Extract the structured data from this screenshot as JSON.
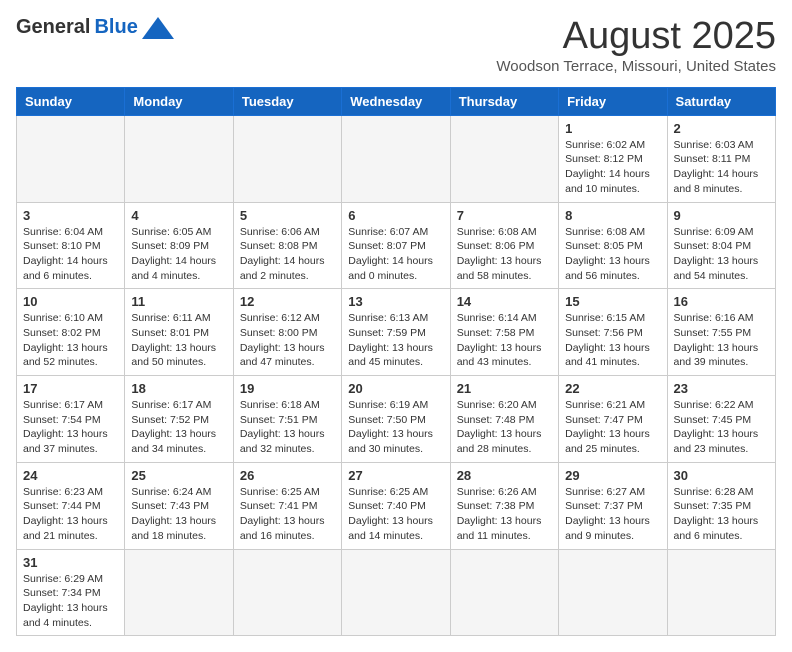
{
  "header": {
    "logo_general": "General",
    "logo_blue": "Blue",
    "month_title": "August 2025",
    "location": "Woodson Terrace, Missouri, United States"
  },
  "weekdays": [
    "Sunday",
    "Monday",
    "Tuesday",
    "Wednesday",
    "Thursday",
    "Friday",
    "Saturday"
  ],
  "weeks": [
    [
      {
        "day": "",
        "info": ""
      },
      {
        "day": "",
        "info": ""
      },
      {
        "day": "",
        "info": ""
      },
      {
        "day": "",
        "info": ""
      },
      {
        "day": "",
        "info": ""
      },
      {
        "day": "1",
        "info": "Sunrise: 6:02 AM\nSunset: 8:12 PM\nDaylight: 14 hours and 10 minutes."
      },
      {
        "day": "2",
        "info": "Sunrise: 6:03 AM\nSunset: 8:11 PM\nDaylight: 14 hours and 8 minutes."
      }
    ],
    [
      {
        "day": "3",
        "info": "Sunrise: 6:04 AM\nSunset: 8:10 PM\nDaylight: 14 hours and 6 minutes."
      },
      {
        "day": "4",
        "info": "Sunrise: 6:05 AM\nSunset: 8:09 PM\nDaylight: 14 hours and 4 minutes."
      },
      {
        "day": "5",
        "info": "Sunrise: 6:06 AM\nSunset: 8:08 PM\nDaylight: 14 hours and 2 minutes."
      },
      {
        "day": "6",
        "info": "Sunrise: 6:07 AM\nSunset: 8:07 PM\nDaylight: 14 hours and 0 minutes."
      },
      {
        "day": "7",
        "info": "Sunrise: 6:08 AM\nSunset: 8:06 PM\nDaylight: 13 hours and 58 minutes."
      },
      {
        "day": "8",
        "info": "Sunrise: 6:08 AM\nSunset: 8:05 PM\nDaylight: 13 hours and 56 minutes."
      },
      {
        "day": "9",
        "info": "Sunrise: 6:09 AM\nSunset: 8:04 PM\nDaylight: 13 hours and 54 minutes."
      }
    ],
    [
      {
        "day": "10",
        "info": "Sunrise: 6:10 AM\nSunset: 8:02 PM\nDaylight: 13 hours and 52 minutes."
      },
      {
        "day": "11",
        "info": "Sunrise: 6:11 AM\nSunset: 8:01 PM\nDaylight: 13 hours and 50 minutes."
      },
      {
        "day": "12",
        "info": "Sunrise: 6:12 AM\nSunset: 8:00 PM\nDaylight: 13 hours and 47 minutes."
      },
      {
        "day": "13",
        "info": "Sunrise: 6:13 AM\nSunset: 7:59 PM\nDaylight: 13 hours and 45 minutes."
      },
      {
        "day": "14",
        "info": "Sunrise: 6:14 AM\nSunset: 7:58 PM\nDaylight: 13 hours and 43 minutes."
      },
      {
        "day": "15",
        "info": "Sunrise: 6:15 AM\nSunset: 7:56 PM\nDaylight: 13 hours and 41 minutes."
      },
      {
        "day": "16",
        "info": "Sunrise: 6:16 AM\nSunset: 7:55 PM\nDaylight: 13 hours and 39 minutes."
      }
    ],
    [
      {
        "day": "17",
        "info": "Sunrise: 6:17 AM\nSunset: 7:54 PM\nDaylight: 13 hours and 37 minutes."
      },
      {
        "day": "18",
        "info": "Sunrise: 6:17 AM\nSunset: 7:52 PM\nDaylight: 13 hours and 34 minutes."
      },
      {
        "day": "19",
        "info": "Sunrise: 6:18 AM\nSunset: 7:51 PM\nDaylight: 13 hours and 32 minutes."
      },
      {
        "day": "20",
        "info": "Sunrise: 6:19 AM\nSunset: 7:50 PM\nDaylight: 13 hours and 30 minutes."
      },
      {
        "day": "21",
        "info": "Sunrise: 6:20 AM\nSunset: 7:48 PM\nDaylight: 13 hours and 28 minutes."
      },
      {
        "day": "22",
        "info": "Sunrise: 6:21 AM\nSunset: 7:47 PM\nDaylight: 13 hours and 25 minutes."
      },
      {
        "day": "23",
        "info": "Sunrise: 6:22 AM\nSunset: 7:45 PM\nDaylight: 13 hours and 23 minutes."
      }
    ],
    [
      {
        "day": "24",
        "info": "Sunrise: 6:23 AM\nSunset: 7:44 PM\nDaylight: 13 hours and 21 minutes."
      },
      {
        "day": "25",
        "info": "Sunrise: 6:24 AM\nSunset: 7:43 PM\nDaylight: 13 hours and 18 minutes."
      },
      {
        "day": "26",
        "info": "Sunrise: 6:25 AM\nSunset: 7:41 PM\nDaylight: 13 hours and 16 minutes."
      },
      {
        "day": "27",
        "info": "Sunrise: 6:25 AM\nSunset: 7:40 PM\nDaylight: 13 hours and 14 minutes."
      },
      {
        "day": "28",
        "info": "Sunrise: 6:26 AM\nSunset: 7:38 PM\nDaylight: 13 hours and 11 minutes."
      },
      {
        "day": "29",
        "info": "Sunrise: 6:27 AM\nSunset: 7:37 PM\nDaylight: 13 hours and 9 minutes."
      },
      {
        "day": "30",
        "info": "Sunrise: 6:28 AM\nSunset: 7:35 PM\nDaylight: 13 hours and 6 minutes."
      }
    ],
    [
      {
        "day": "31",
        "info": "Sunrise: 6:29 AM\nSunset: 7:34 PM\nDaylight: 13 hours and 4 minutes."
      },
      {
        "day": "",
        "info": ""
      },
      {
        "day": "",
        "info": ""
      },
      {
        "day": "",
        "info": ""
      },
      {
        "day": "",
        "info": ""
      },
      {
        "day": "",
        "info": ""
      },
      {
        "day": "",
        "info": ""
      }
    ]
  ]
}
